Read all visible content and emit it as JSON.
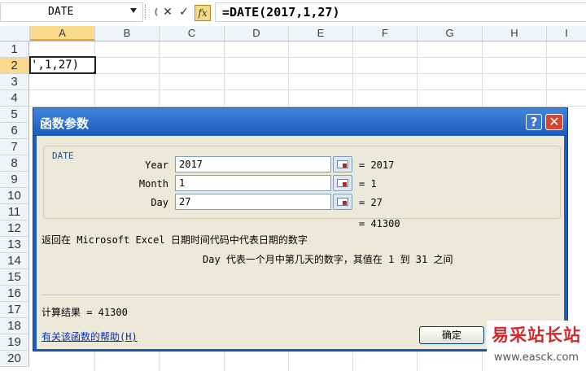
{
  "formula_bar": {
    "name_box": "DATE",
    "cancel_icon": "✕",
    "enter_icon": "✓",
    "fx_label": "fx",
    "formula": "=DATE(2017,1,27)"
  },
  "columns": [
    "A",
    "B",
    "C",
    "D",
    "E",
    "F",
    "G",
    "H",
    "I"
  ],
  "rows": [
    "1",
    "2",
    "3",
    "4",
    "5",
    "6",
    "7",
    "8",
    "9",
    "10",
    "11",
    "12",
    "13",
    "14",
    "15",
    "16",
    "17",
    "18",
    "19",
    "20"
  ],
  "active_cell_text": "',1,27)",
  "dialog": {
    "title": "函数参数",
    "help_icon": "?",
    "close_icon": "✕",
    "function_name": "DATE",
    "args": [
      {
        "label": "Year",
        "value": "2017",
        "result": "= 2017"
      },
      {
        "label": "Month",
        "value": "1",
        "result": "= 1"
      },
      {
        "label": "Day",
        "value": "27",
        "result": "= 27"
      }
    ],
    "total": "= 41300",
    "description": "返回在 Microsoft Excel 日期时间代码中代表日期的数字",
    "arg_help": "Day  代表一个月中第几天的数字，其值在 1 到 31 之间",
    "calc_result": "计算结果 =  41300",
    "help_link": "有关该函数的帮助(H)",
    "ok_label": "确定"
  },
  "watermark": {
    "title": "易采站长站",
    "url": "www.easck.com"
  }
}
